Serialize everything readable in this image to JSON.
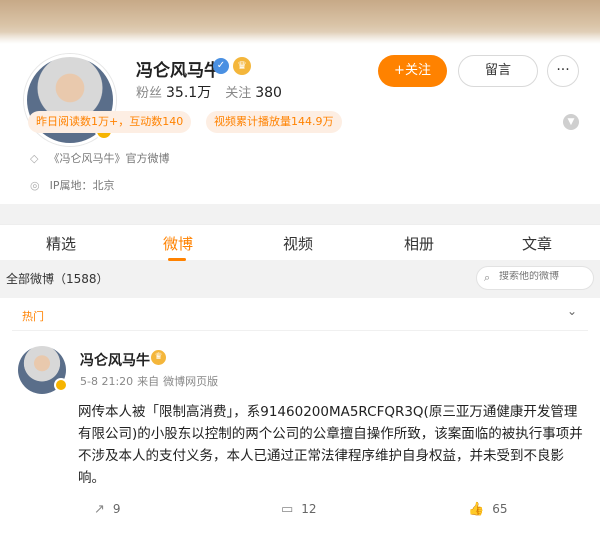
{
  "profile": {
    "name": "冯仑风马牛",
    "fans_label": "粉丝",
    "fans_count": "35.1万",
    "following_label": "关注",
    "following_count": "380",
    "follow_button": "+关注",
    "message_button": "留言",
    "more_button": "···",
    "tags": [
      "昨日阅读数1万+，互动数140",
      "视频累计播放量144.9万"
    ],
    "official_info": "《冯仑风马牛》官方微博",
    "ip_location": "IP属地：北京"
  },
  "tabs": [
    "精选",
    "微博",
    "视频",
    "相册",
    "文章"
  ],
  "active_tab": "微博",
  "feed": {
    "all_label": "全部微博（1588）",
    "search_placeholder": "搜索他的微博",
    "hot_label": "热门"
  },
  "post": {
    "author": "冯仑风马牛",
    "time": "5-8 21:20",
    "source_prefix": "来自",
    "source": "微博网页版",
    "text": "网传本人被「限制高消费」，系91460200MA5RCFQR3Q(原三亚万通健康开发管理有限公司)的小股东以控制的两个公司的公章擅自操作所致，该案面临的被执行事项并不涉及本人的支付义务，本人已通过正常法律程序维护自身权益，并未受到不良影响。",
    "reposts": "9",
    "comments": "12",
    "likes": "65"
  },
  "icons": {
    "verify": "verified-check-icon",
    "vip": "crown-icon",
    "expand": "chevron-down-icon",
    "official": "shield-icon",
    "location": "location-pin-icon",
    "search": "search-icon",
    "repost": "share-icon",
    "comment": "comment-icon",
    "like": "thumb-up-icon"
  },
  "colors": {
    "accent": "#ff8200",
    "tag_bg": "#fdeee3",
    "verify": "#4a90e2",
    "vip": "#f4b63b"
  }
}
